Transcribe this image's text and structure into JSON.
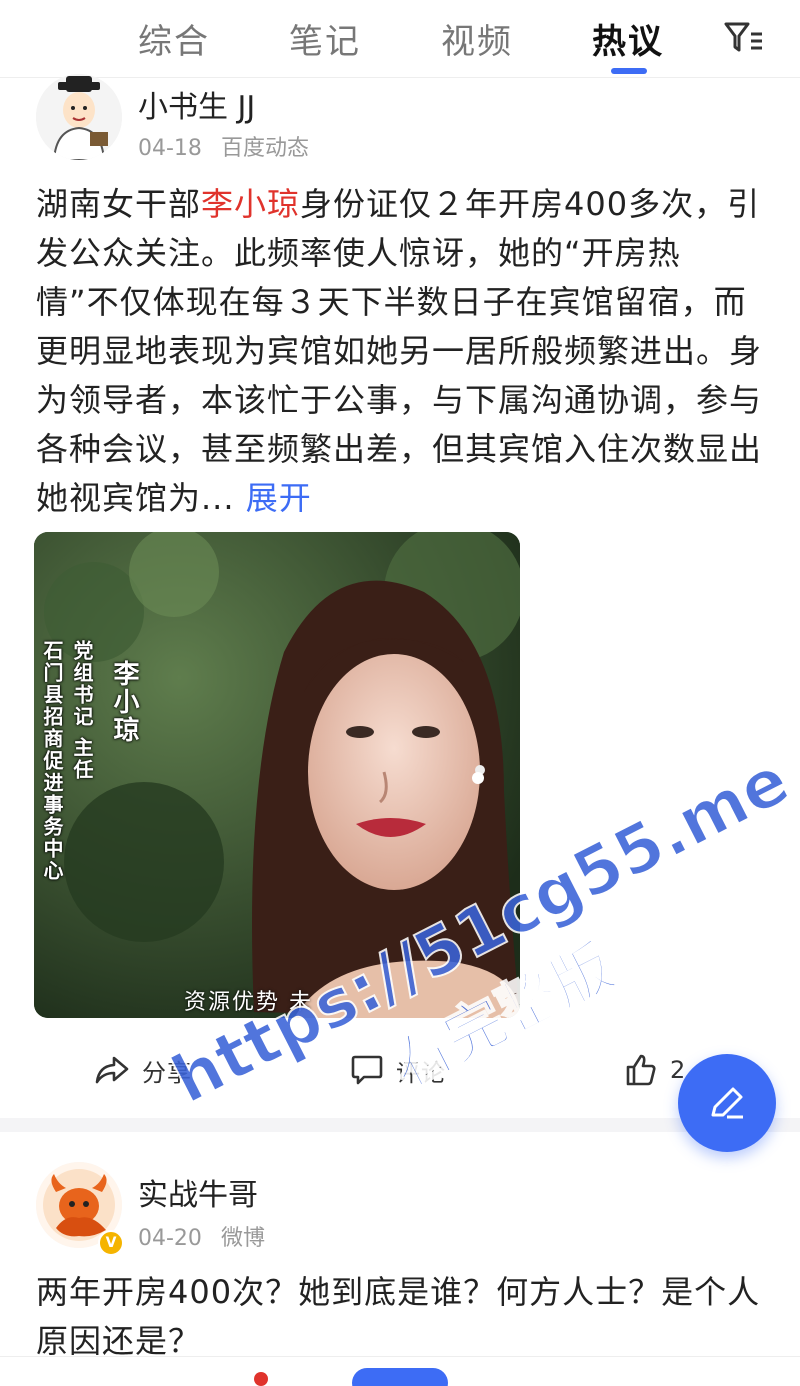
{
  "tabs": [
    {
      "label": "综合"
    },
    {
      "label": "笔记"
    },
    {
      "label": "视频"
    },
    {
      "label": "热议",
      "active": true
    }
  ],
  "icons": {
    "filter": "filter-list-icon",
    "share": "share-arrow-icon",
    "comment": "comment-bubble-icon",
    "like": "thumbs-up-icon",
    "compose": "pencil-icon"
  },
  "colors": {
    "accent": "#3d6cf5",
    "highlight": "#e0332c",
    "meta": "#999999"
  },
  "post1": {
    "author": "小书生 JJ",
    "date": "04-18",
    "source": "百度动态",
    "text_before": "湖南女干部",
    "text_highlight": "李小琼",
    "text_after": "身份证仅２年开房400多次，引发公众关注。此频率使人惊讶，她的“开房热情”不仅体现在每３天下半数日子在宾馆留宿，而更明显地表现为宾馆如她另一居所般频繁进出。身为领导者，本该忙于公事，与下属沟通协调，参与各种会议，甚至频繁出差，但其宾馆入住次数显出她视宾馆为...",
    "expand_label": "展开",
    "image": {
      "name_text": "李小琼",
      "title_col1": "党组书记 主任",
      "title_col2": "石门县招商促进事务中心",
      "caption": "资源优势 未"
    },
    "actions": {
      "share": "分享",
      "comment": "评论",
      "like": "2"
    }
  },
  "post2": {
    "author": "实战牛哥",
    "date": "04-20",
    "source": "微博",
    "text": "两年开房400次？她到底是谁？何方人士？是个人原因还是？"
  },
  "watermark": {
    "line1": "https://51cg55.me",
    "line2": "看完整版"
  }
}
